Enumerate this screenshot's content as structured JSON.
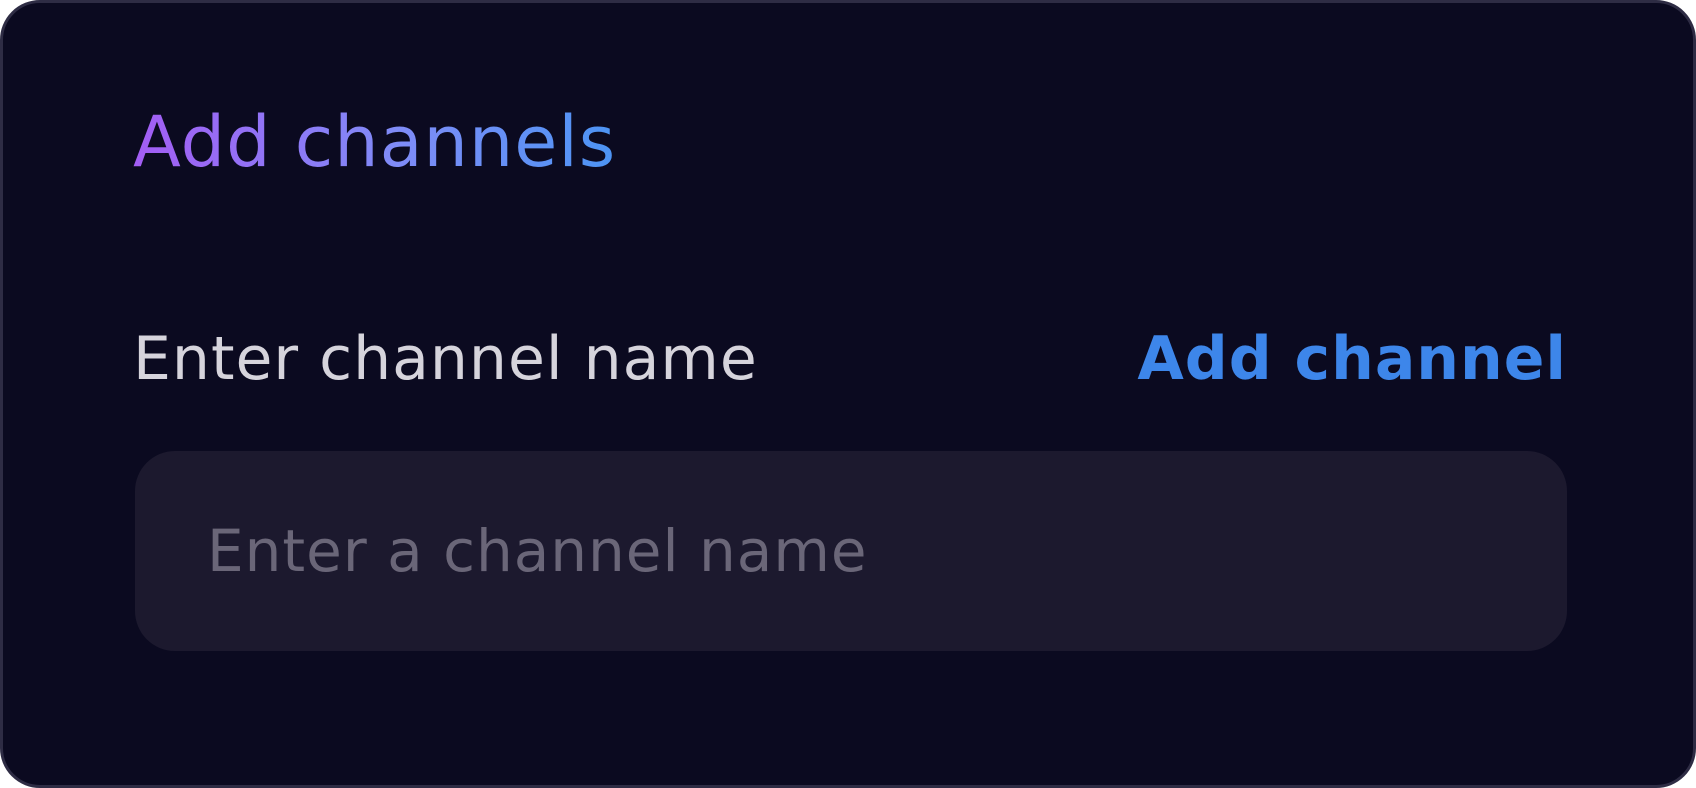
{
  "dialog": {
    "title": "Add channels",
    "field_label": "Enter channel name",
    "add_button_label": "Add channel",
    "input": {
      "value": "",
      "placeholder": "Enter a channel name"
    }
  },
  "colors": {
    "background": "#0b0a20",
    "border": "#2e2c44",
    "title_gradient_start": "#a35df4",
    "title_gradient_end": "#4c94f4",
    "accent": "#3d86ea",
    "label_text": "#d6d4dc",
    "input_background": "#1c192e",
    "placeholder_text": "#6a6678"
  }
}
